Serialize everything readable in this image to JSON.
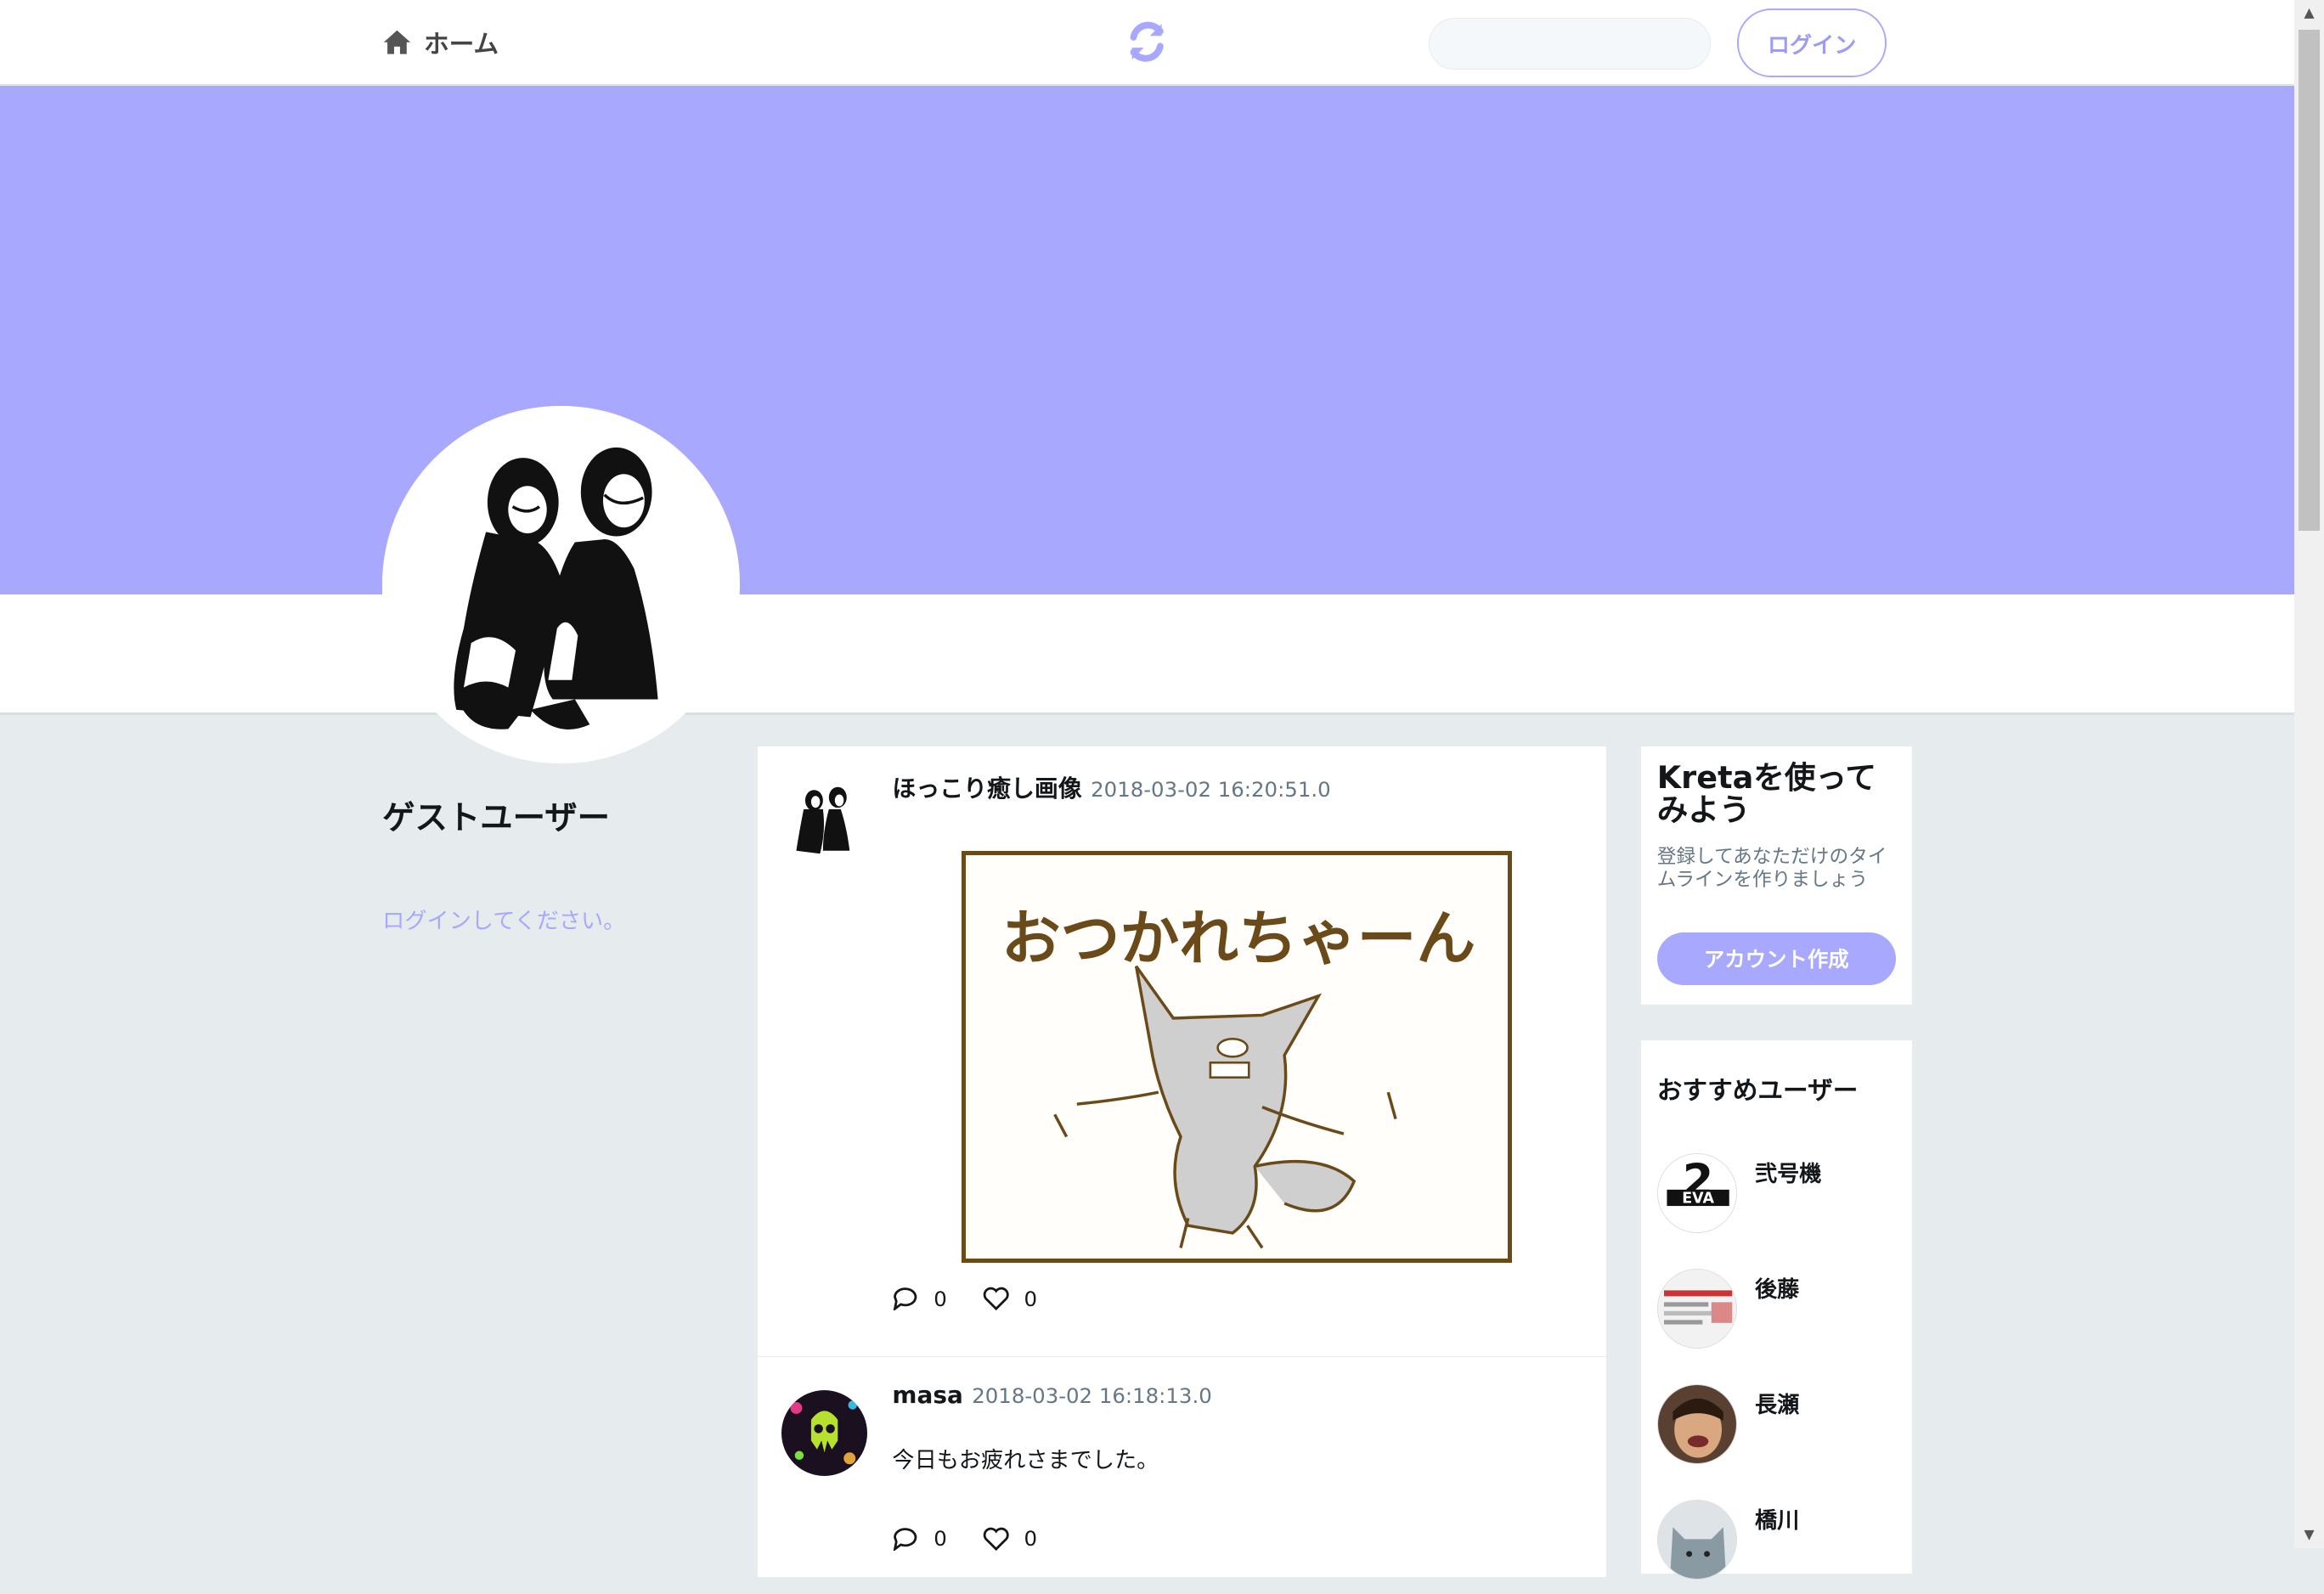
{
  "nav": {
    "home_label": "ホーム",
    "login_label": "ログイン",
    "search_placeholder": ""
  },
  "profile": {
    "name": "ゲストユーザー",
    "login_prompt": "ログインしてください。"
  },
  "posts": [
    {
      "user": "ほっこり癒し画像",
      "date": "2018-03-02 16:20:51.0",
      "image_caption": "おつかれちゃーん",
      "replies": "0",
      "likes": "0"
    },
    {
      "user": "masa",
      "date": "2018-03-02 16:18:13.0",
      "text": "今日もお疲れさまでした。",
      "replies": "0",
      "likes": "0"
    }
  ],
  "try_card": {
    "title": "Kretaを使ってみよう",
    "subtitle": "登録してあなただけのタイムラインを作りましょう",
    "button": "アカウント作成"
  },
  "recommend": {
    "title": "おすすめユーザー",
    "users": [
      {
        "name": "弐号機"
      },
      {
        "name": "後藤"
      },
      {
        "name": "長瀬"
      },
      {
        "name": "橋川"
      }
    ]
  },
  "colors": {
    "accent": "#a8a8ff",
    "background": "#e6ebee"
  }
}
